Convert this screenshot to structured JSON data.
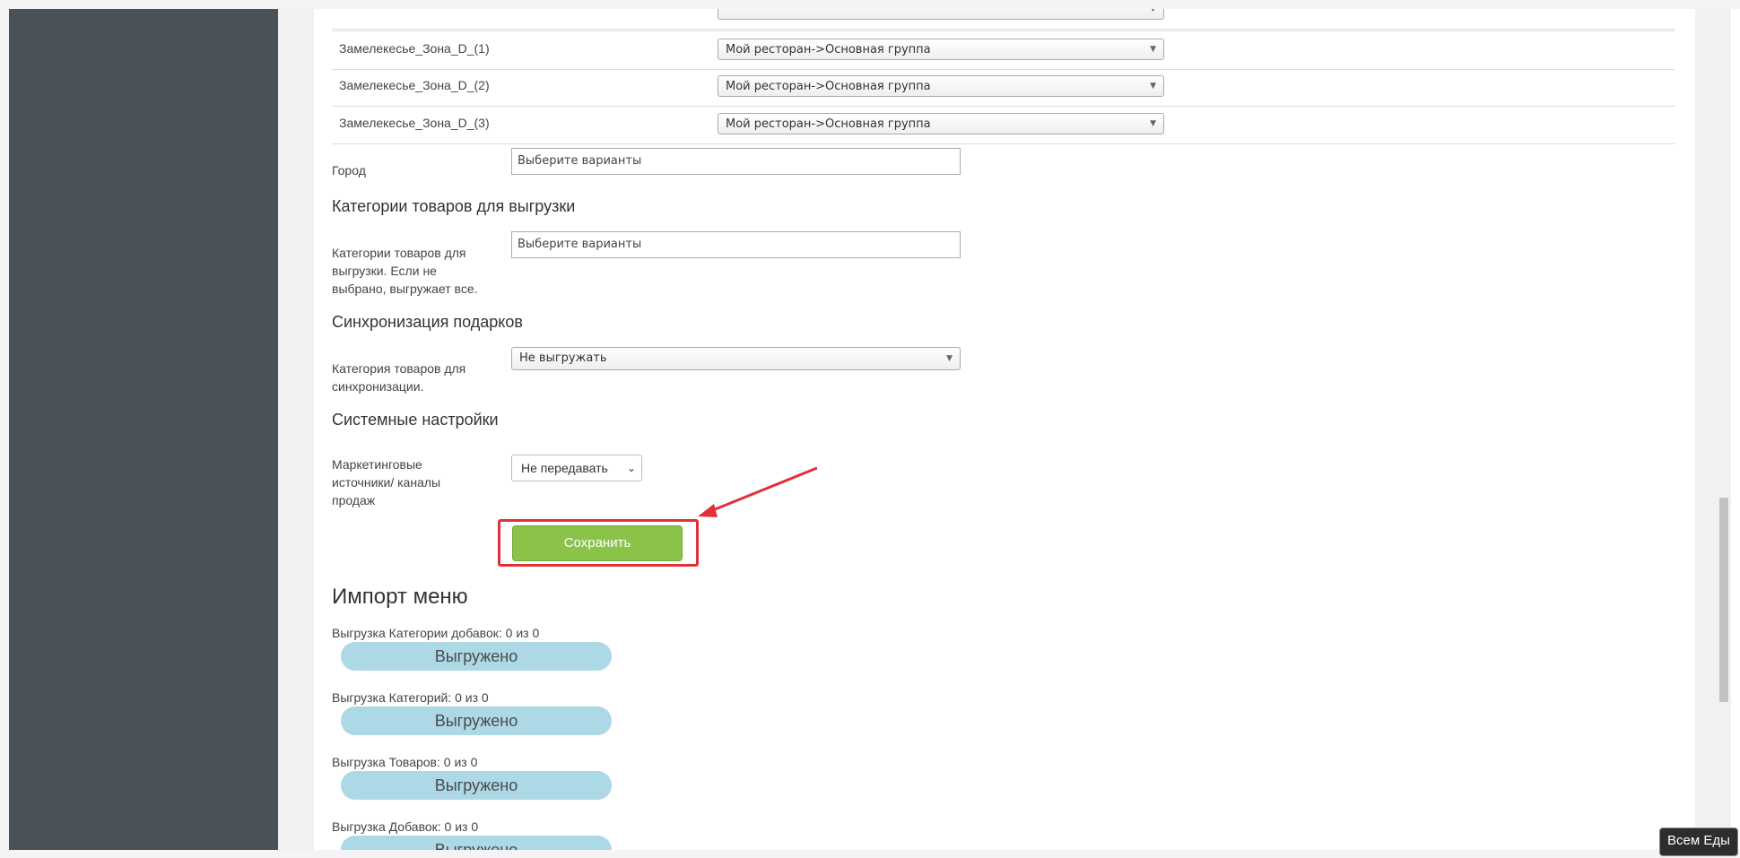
{
  "zones": [
    {
      "name": "Замелекесье_Зона_D_(1)",
      "value": "Мой ресторан->Основная группа"
    },
    {
      "name": "Замелекесье_Зона_D_(2)",
      "value": "Мой ресторан->Основная группа"
    },
    {
      "name": "Замелекесье_Зона_D_(3)",
      "value": "Мой ресторан->Основная группа"
    }
  ],
  "city": {
    "label": "Город",
    "placeholder": "Выберите варианты"
  },
  "categories_section": {
    "title": "Категории товаров для выгрузки",
    "label_lines": [
      "Категории товаров для",
      "выгрузки. Если не",
      "выбрано, выгружает все."
    ],
    "placeholder": "Выберите варианты"
  },
  "gifts_section": {
    "title": "Синхронизация подарков",
    "label_lines": [
      "Категория товаров для",
      "синхронизации."
    ],
    "value": "Не выгружать"
  },
  "system_section": {
    "title": "Системные настройки",
    "label_lines": [
      "Маркетинговые",
      "источники/ каналы",
      "продаж"
    ],
    "value": "Не передавать"
  },
  "save_label": "Сохранить",
  "import": {
    "title": "Импорт меню",
    "items": [
      {
        "label": "Выгрузка Категории добавок: 0 из 0",
        "status": "Выгружено",
        "progress": 1.0
      },
      {
        "label": "Выгрузка Категорий: 0 из 0",
        "status": "Выгружено",
        "progress": 1.0
      },
      {
        "label": "Выгрузка Товаров: 0 из 0",
        "status": "Выгружено",
        "progress": 1.0
      },
      {
        "label": "Выгрузка Добавок: 0 из 0",
        "status": "Выгружено",
        "progress": 1.0
      }
    ]
  },
  "badge": "Всем Еды",
  "colors": {
    "sidebar": "#4a5259",
    "save_button": "#8bc34a",
    "progress_bar": "#add8e6",
    "highlight": "#e0303a"
  }
}
